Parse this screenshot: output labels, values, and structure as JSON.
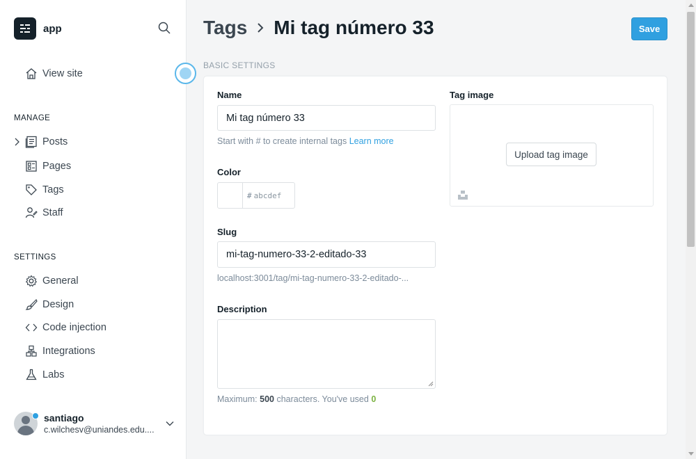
{
  "sidebar": {
    "brand_name": "app",
    "view_site": "View site",
    "manage_label": "MANAGE",
    "manage_items": [
      "Posts",
      "Pages",
      "Tags",
      "Staff"
    ],
    "settings_label": "SETTINGS",
    "settings_items": [
      "General",
      "Design",
      "Code injection",
      "Integrations",
      "Labs"
    ],
    "user": {
      "name": "santiago",
      "email": "c.wilchesv@uniandes.edu...."
    }
  },
  "header": {
    "breadcrumb": "Tags",
    "title": "Mi tag número 33",
    "save_label": "Save"
  },
  "form": {
    "group_label": "Basic settings",
    "name_label": "Name",
    "name_value": "Mi tag número 33",
    "name_hint": "Start with # to create internal tags",
    "name_hint_link": "Learn more",
    "color_label": "Color",
    "color_hash": "#",
    "color_placeholder": "abcdef",
    "slug_label": "Slug",
    "slug_value": "mi-tag-numero-33-2-editado-33",
    "slug_url": "localhost:3001/tag/mi-tag-numero-33-2-editado-...",
    "description_label": "Description",
    "description_value": "",
    "counter_prefix": "Maximum:",
    "counter_max": "500",
    "counter_mid": "characters. You've used",
    "counter_used": "0",
    "tag_image_label": "Tag image",
    "upload_label": "Upload tag image"
  },
  "colors": {
    "accent": "#30a0e0",
    "dark": "#15212a",
    "muted": "#7c8b9a",
    "success": "#7bb241"
  }
}
